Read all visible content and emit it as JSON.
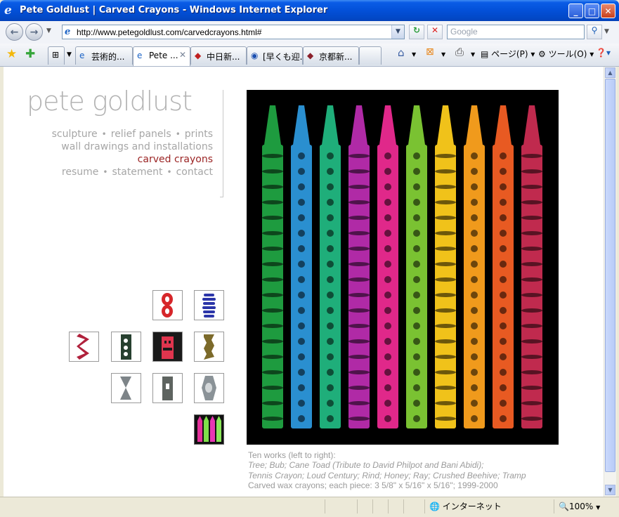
{
  "window": {
    "title": "Pete Goldlust | Carved Crayons - Windows Internet Explorer",
    "buttons": {
      "minimize": "_",
      "maximize": "□",
      "close": "✕"
    }
  },
  "address_bar": {
    "url": "http://www.petegoldlust.com/carvedcrayons.html#",
    "search_placeholder": "Google"
  },
  "tabs": [
    {
      "label": "芸術的...",
      "active": false
    },
    {
      "label": "Pete ...",
      "active": true
    },
    {
      "label": "中日新...",
      "active": false
    },
    {
      "label": "[早くも迎...",
      "active": false
    },
    {
      "label": "京都新...",
      "active": false
    }
  ],
  "command_bar": {
    "page_label": "ページ(P)",
    "tools_label": "ツール(O)"
  },
  "site": {
    "name": "pete goldlust",
    "nav": {
      "row1": [
        "sculpture",
        "relief panels",
        "prints"
      ],
      "row2": "wall drawings and installations",
      "current": "carved crayons",
      "row4": [
        "resume",
        "statement",
        "contact"
      ],
      "separator": "•"
    },
    "caption": {
      "line1": "Ten works (left to right):",
      "line2": "Tree; Bub; Cane Toad (Tribute to David Philpot and Bani Abidi);",
      "line3": "Tennis Crayon; Loud Century; Rind; Honey; Ray; Crushed Beehive; Tramp",
      "line4": "Carved wax crayons; each piece: 3 5/8\" x 5/16\" x 5/16\"; 1999-2000"
    },
    "crayon_colors": [
      "#1e9b3f",
      "#2a8fd0",
      "#1fae7a",
      "#b02aa6",
      "#e0288a",
      "#7ac232",
      "#f0c21a",
      "#f09a1c",
      "#e85a22",
      "#c02a4e"
    ]
  },
  "status_bar": {
    "zone": "インターネット",
    "zoom": "100%"
  }
}
